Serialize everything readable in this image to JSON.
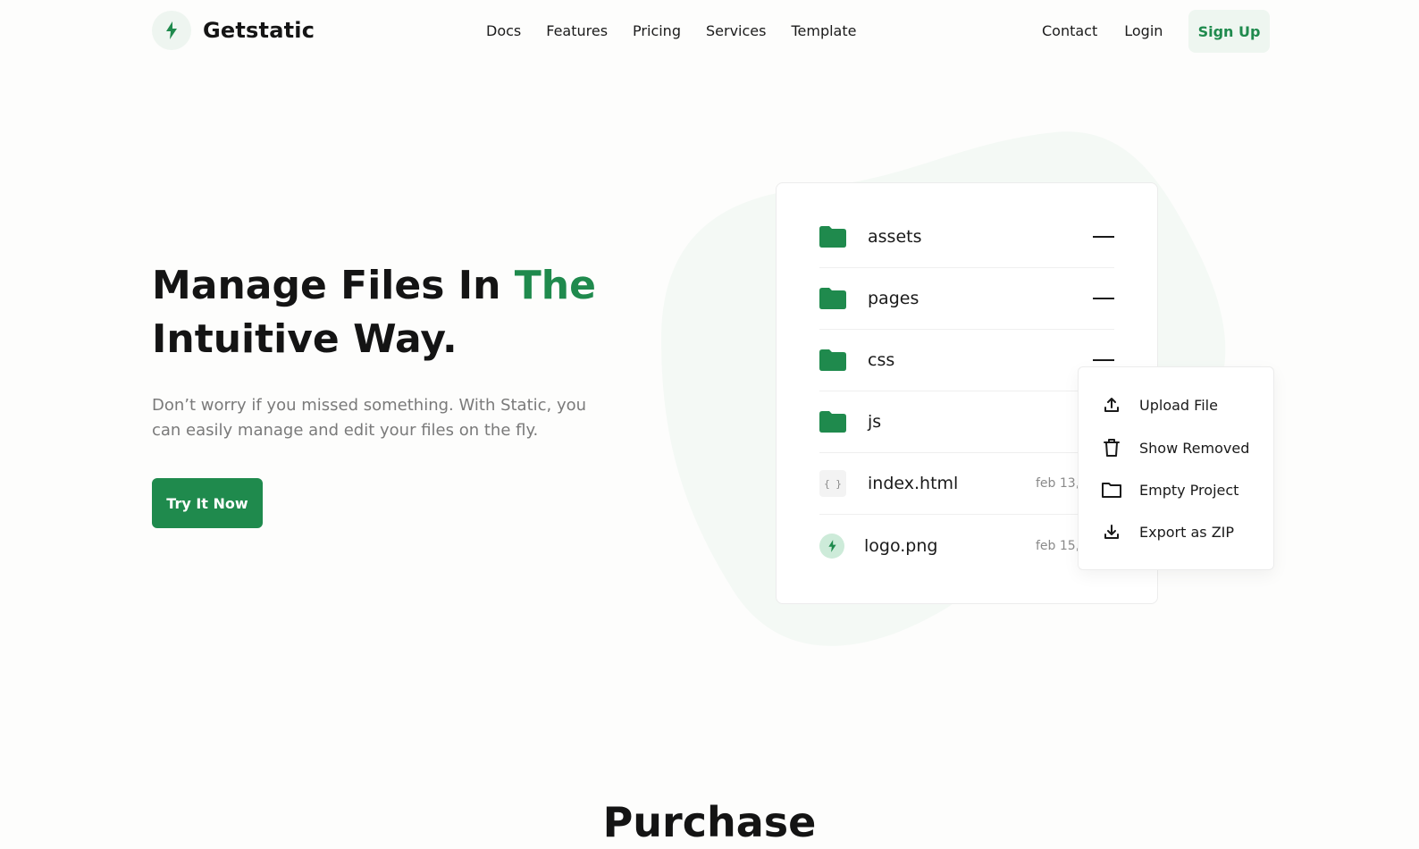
{
  "brand": {
    "name": "Getstatic",
    "logo_icon": "bolt-icon",
    "accent": "#1f8a4d"
  },
  "nav": {
    "items": [
      {
        "label": "Docs"
      },
      {
        "label": "Features"
      },
      {
        "label": "Pricing"
      },
      {
        "label": "Services"
      },
      {
        "label": "Template"
      }
    ],
    "contact": "Contact",
    "login": "Login",
    "signup": "Sign Up"
  },
  "hero": {
    "title_part1": "Manage Files In ",
    "title_accent": "The",
    "title_part2": "Intuitive Way.",
    "subtitle": "Don’t worry if you missed something. With Static, you can easily manage and edit your files on the fly.",
    "cta": "Try It Now"
  },
  "files": [
    {
      "name": "assets",
      "type": "folder"
    },
    {
      "name": "pages",
      "type": "folder"
    },
    {
      "name": "css",
      "type": "folder"
    },
    {
      "name": "js",
      "type": "folder"
    },
    {
      "name": "index.html",
      "type": "code",
      "badge": "{ }",
      "date": "feb 13,"
    },
    {
      "name": "logo.png",
      "type": "image",
      "date": "feb 15,"
    }
  ],
  "menu": [
    {
      "label": "Upload File",
      "icon": "upload-icon"
    },
    {
      "label": "Show Removed",
      "icon": "trash-icon"
    },
    {
      "label": "Empty Project",
      "icon": "folder-outline-icon"
    },
    {
      "label": "Export as ZIP",
      "icon": "download-icon"
    }
  ],
  "purchase_heading": "Purchase"
}
